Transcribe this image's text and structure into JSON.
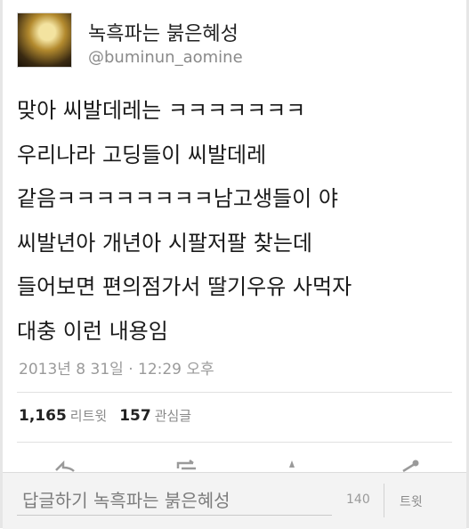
{
  "author": {
    "display_name": "녹흑파는 붉은혜성",
    "handle": "@buminun_aomine"
  },
  "tweet": {
    "lines": [
      "맞아 씨발데레는 ㅋㅋㅋㅋㅋㅋㅋ",
      "우리나라 고딩들이 씨발데레",
      "같음ㅋㅋㅋㅋㅋㅋㅋㅋ남고생들이 야",
      "씨발년아 개년아 시팔저팔 찾는데",
      "들어보면 편의점가서 딸기우유 사먹자",
      "대충 이런 내용임"
    ],
    "timestamp": "2013년 8 31일 · 12:29 오후"
  },
  "stats": {
    "retweets_count": "1,165",
    "retweets_label": "리트윗",
    "favorites_count": "157",
    "favorites_label": "관심글"
  },
  "actions": {
    "icons": [
      "reply-icon",
      "retweet-icon",
      "favorite-icon",
      "share-icon"
    ]
  },
  "reply_bar": {
    "placeholder": "답글하기 녹흑파는 붉은혜성",
    "char_count": "140",
    "tweet_button": "트윗"
  }
}
